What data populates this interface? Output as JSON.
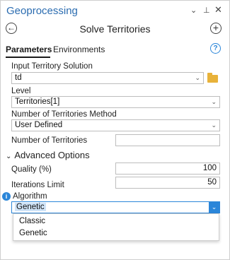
{
  "titlebar": {
    "title": "Geoprocessing",
    "pin_glyph": "↓",
    "pin_icon": "pin-icon",
    "close_icon": "close-icon"
  },
  "nav": {
    "back_icon": "back-arrow-icon",
    "tool_title": "Solve Territories",
    "add_icon": "add-icon"
  },
  "tabs": [
    {
      "label": "Parameters",
      "active": true
    },
    {
      "label": "Environments",
      "active": false
    }
  ],
  "help_icon": "help-icon",
  "params": {
    "input_label": "Input Territory Solution",
    "input_value": "td",
    "level_label": "Level",
    "level_value": "Territories[1]",
    "method_label": "Number of Territories Method",
    "method_value": "User Defined",
    "num_label": "Number of Territories",
    "num_value": ""
  },
  "advanced": {
    "header": "Advanced Options",
    "quality_label": "Quality (%)",
    "quality_value": "100",
    "iterations_label": "Iterations Limit",
    "iterations_value": "50",
    "algorithm_label": "Algorithm",
    "algorithm_value": "Genetic",
    "algorithm_options": [
      "Classic",
      "Genetic"
    ]
  },
  "colors": {
    "accent": "#2b86d9",
    "title_blue": "#2b6cb0",
    "selection": "#cfe3f7"
  }
}
